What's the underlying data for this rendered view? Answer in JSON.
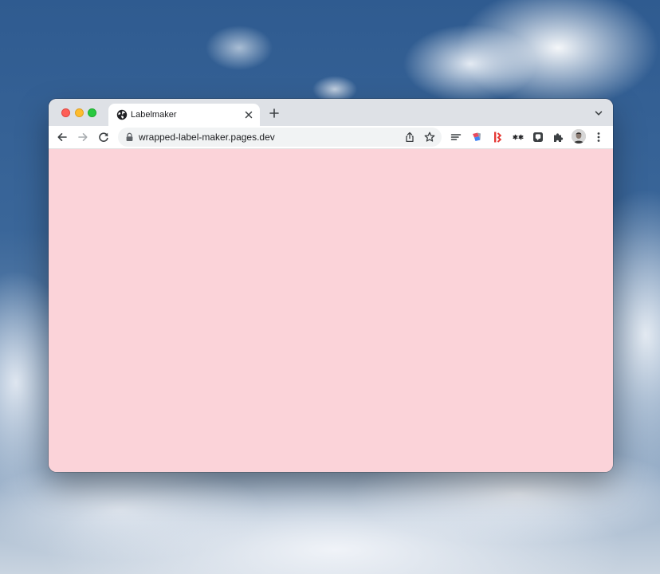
{
  "browser": {
    "tab": {
      "title": "Labelmaker",
      "favicon": "globe-icon"
    },
    "address_bar": {
      "url": "wrapped-label-maker.pages.dev"
    },
    "extensions": [
      "text-lines-icon",
      "color-picker-extension-icon",
      "red-bracket-extension-icon",
      "asterisk-extension-icon",
      "square-extension-icon",
      "puzzle-icon"
    ]
  },
  "colors": {
    "page_background": "#fbd3d9",
    "chrome_frame": "#dee1e6",
    "traffic_close": "#fe5f57",
    "traffic_minimize": "#febc2e",
    "traffic_maximize": "#28c840"
  }
}
